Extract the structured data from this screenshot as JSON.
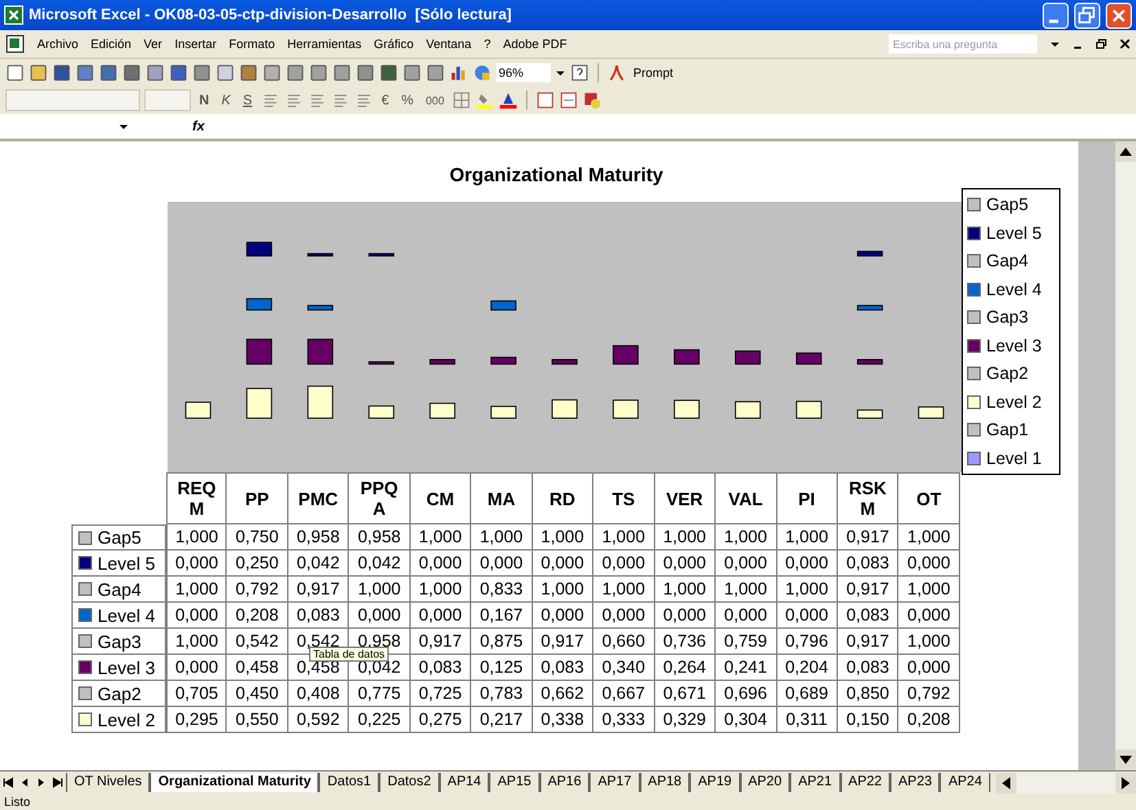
{
  "window": {
    "title": "Microsoft Excel - OK08-03-05-ctp-division-Desarrollo  [Sólo lectura]"
  },
  "menu": [
    "Archivo",
    "Edición",
    "Ver",
    "Insertar",
    "Formato",
    "Herramientas",
    "Gráfico",
    "Ventana",
    "?",
    "Adobe PDF"
  ],
  "help_search": {
    "placeholder": "Escriba una pregunta"
  },
  "toolbar": {
    "zoom": "96%",
    "prompt": "Prompt"
  },
  "format_toolbar": {
    "bold": "N",
    "italic": "K",
    "underline": "S",
    "currency": "€",
    "percent": "%",
    "thousands": "000"
  },
  "formula_bar": {
    "fx": "fx"
  },
  "chart": {
    "title": "Organizational Maturity",
    "legend": [
      {
        "name": "Gap5",
        "color": "#c0c0c0"
      },
      {
        "name": "Level 5",
        "color": "#000080"
      },
      {
        "name": "Gap4",
        "color": "#c0c0c0"
      },
      {
        "name": "Level 4",
        "color": "#0066cc"
      },
      {
        "name": "Gap3",
        "color": "#c0c0c0"
      },
      {
        "name": "Level 3",
        "color": "#660066"
      },
      {
        "name": "Gap2",
        "color": "#c0c0c0"
      },
      {
        "name": "Level 2",
        "color": "#ffffcc"
      },
      {
        "name": "Gap1",
        "color": "#c0c0c0"
      },
      {
        "name": "Level 1",
        "color": "#9999ff"
      }
    ],
    "data_table": {
      "columns": [
        "REQM",
        "PP",
        "PMC",
        "PPQA",
        "CM",
        "MA",
        "RD",
        "TS",
        "VER",
        "VAL",
        "PI",
        "RSKM",
        "OT"
      ],
      "rows": [
        {
          "name": "Gap5",
          "color": "#c0c0c0",
          "cells": [
            "1,000",
            "0,750",
            "0,958",
            "0,958",
            "1,000",
            "1,000",
            "1,000",
            "1,000",
            "1,000",
            "1,000",
            "1,000",
            "0,917",
            "1,000"
          ]
        },
        {
          "name": "Level 5",
          "color": "#000080",
          "cells": [
            "0,000",
            "0,250",
            "0,042",
            "0,042",
            "0,000",
            "0,000",
            "0,000",
            "0,000",
            "0,000",
            "0,000",
            "0,000",
            "0,083",
            "0,000"
          ]
        },
        {
          "name": "Gap4",
          "color": "#c0c0c0",
          "cells": [
            "1,000",
            "0,792",
            "0,917",
            "1,000",
            "1,000",
            "0,833",
            "1,000",
            "1,000",
            "1,000",
            "1,000",
            "1,000",
            "0,917",
            "1,000"
          ]
        },
        {
          "name": "Level 4",
          "color": "#0066cc",
          "cells": [
            "0,000",
            "0,208",
            "0,083",
            "0,000",
            "0,000",
            "0,167",
            "0,000",
            "0,000",
            "0,000",
            "0,000",
            "0,000",
            "0,083",
            "0,000"
          ]
        },
        {
          "name": "Gap3",
          "color": "#c0c0c0",
          "cells": [
            "1,000",
            "0,542",
            "0,542",
            "0,958",
            "0,917",
            "0,875",
            "0,917",
            "0,660",
            "0,736",
            "0,759",
            "0,796",
            "0,917",
            "1,000"
          ]
        },
        {
          "name": "Level 3",
          "color": "#660066",
          "cells": [
            "0,000",
            "0,458",
            "0,458",
            "0,042",
            "0,083",
            "0,125",
            "0,083",
            "0,340",
            "0,264",
            "0,241",
            "0,204",
            "0,083",
            "0,000"
          ]
        },
        {
          "name": "Gap2",
          "color": "#c0c0c0",
          "cells": [
            "0,705",
            "0,450",
            "0,408",
            "0,775",
            "0,725",
            "0,783",
            "0,662",
            "0,667",
            "0,671",
            "0,696",
            "0,689",
            "0,850",
            "0,792"
          ]
        },
        {
          "name": "Level 2",
          "color": "#ffffcc",
          "cells": [
            "0,295",
            "0,550",
            "0,592",
            "0,225",
            "0,275",
            "0,217",
            "0,338",
            "0,333",
            "0,329",
            "0,304",
            "0,311",
            "0,150",
            "0,208"
          ]
        }
      ],
      "tooltip": "Tabla de datos"
    }
  },
  "sheet_tabs": [
    {
      "label": "OT Niveles",
      "selected": false
    },
    {
      "label": "Organizational Maturity",
      "selected": true
    },
    {
      "label": "Datos1",
      "selected": false
    },
    {
      "label": "Datos2",
      "selected": false
    },
    {
      "label": "AP14",
      "selected": false
    },
    {
      "label": "AP15",
      "selected": false
    },
    {
      "label": "AP16",
      "selected": false
    },
    {
      "label": "AP17",
      "selected": false
    },
    {
      "label": "AP18",
      "selected": false
    },
    {
      "label": "AP19",
      "selected": false
    },
    {
      "label": "AP20",
      "selected": false
    },
    {
      "label": "AP21",
      "selected": false
    },
    {
      "label": "AP22",
      "selected": false
    },
    {
      "label": "AP23",
      "selected": false
    },
    {
      "label": "AP24",
      "selected": false
    }
  ],
  "status_bar": {
    "text": "Listo"
  }
}
